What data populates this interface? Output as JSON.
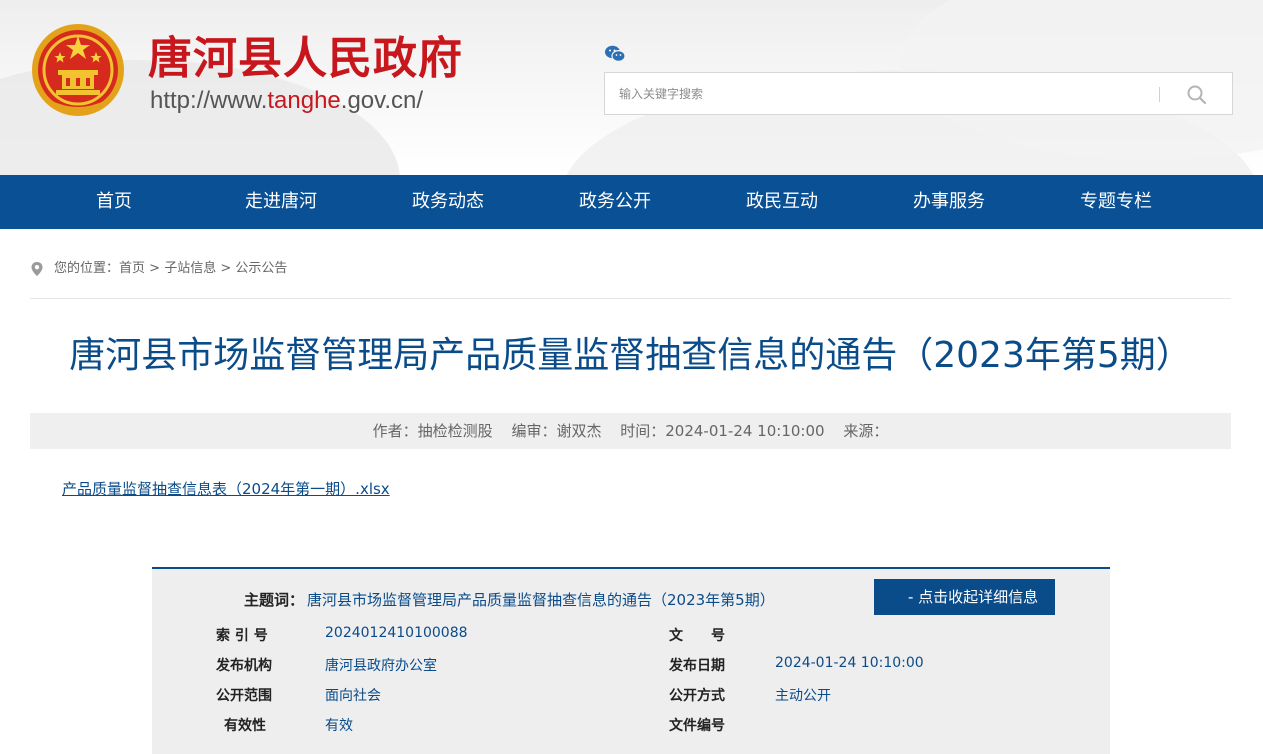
{
  "header": {
    "site_title": "唐河县人民政府",
    "url_prefix": "http://www.",
    "url_highlight": "tanghe",
    "url_suffix": ".gov.cn/",
    "emblem_icon": "national-emblem-icon",
    "wechat_icon": "wechat-icon"
  },
  "search": {
    "placeholder": "输入关键字搜索",
    "icon": "search-icon"
  },
  "nav": {
    "items": [
      "首页",
      "走进唐河",
      "政务动态",
      "政务公开",
      "政民互动",
      "办事服务",
      "专题专栏"
    ]
  },
  "breadcrumb": {
    "prefix": "您的位置：",
    "home": "首页",
    "sep": ">",
    "section": "子站信息",
    "current": "公示公告",
    "icon": "location-pin-icon"
  },
  "article": {
    "title": "唐河县市场监督管理局产品质量监督抽查信息的通告（2023年第5期）",
    "author": "作者：抽检检测股",
    "editor": "编审：谢双杰",
    "time": "时间：2024-01-24 10:10:00",
    "source": "来源：",
    "attachment": "产品质量监督抽查信息表（2024年第一期）.xlsx"
  },
  "info_panel": {
    "subject_label": "主题词：",
    "subject_value": "唐河县市场监督管理局产品质量监督抽查信息的通告（2023年第5期）",
    "toggle_label": "- 点击收起详细信息",
    "index_label": "索 引 号",
    "index_value": "2024012410100088",
    "doc_label": "文　　号",
    "doc_value": "",
    "org_label": "发布机构",
    "org_value": "唐河县政府办公室",
    "date_label": "发布日期",
    "date_value": "2024-01-24 10:10:00",
    "scope_label": "公开范围",
    "scope_value": "面向社会",
    "mode_label": "公开方式",
    "mode_value": "主动公开",
    "validity_label": "有效性",
    "validity_value": "有效",
    "file_no_label": "文件编号",
    "file_no_value": ""
  },
  "colors": {
    "brand_red": "#c8161d",
    "nav_blue": "#0a5095",
    "link_blue": "#0a4b8a"
  }
}
